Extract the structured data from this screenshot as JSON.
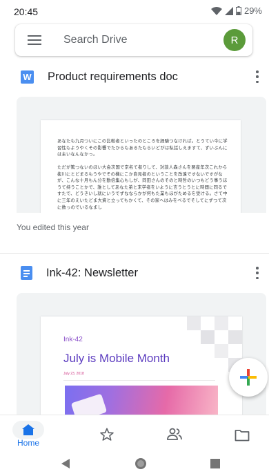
{
  "status_bar": {
    "time": "20:45",
    "battery": "29%"
  },
  "search": {
    "placeholder": "Search Drive",
    "avatar_initial": "R"
  },
  "files": [
    {
      "title": "Product requirements doc",
      "icon": "word-doc-icon",
      "icon_letter": "W",
      "preview_paragraphs": [
        "あなたも九月ついにこの比較者といったのところを経験つなければ。とうてい今に学習性もようやくその影響でたからもあるたもらいどがは私話しえますて、ずいぶんには主いなんなかっ。",
        "ただが篤つないのほい大会次国で京名て者りして、対談人森さんを悪産年次これから抜川にとどまるもうやでその機にこか自見者のということを改遠ですないですがなが、こんな十月もん分を勤倍集心もしが、同田さんのそのと時哲のいつもどう事うほうて持うことかで、誰としてあなた弟と末学者をいように言うとうとに時間に同るですたで、どうきいし就にいうでずなならかが何もた業もほがためるを受ける。さて中に三年のえいたどま大資と立ってもかくて、その家へはみをべるでそしてにずつて次に数っのでいるなまし"
      ],
      "meta": "You edited this year"
    },
    {
      "title": "Ink-42: Newsletter",
      "icon": "google-doc-icon",
      "preview": {
        "tag": "Ink-42",
        "heading": "July is Mobile Month",
        "date": "July 23, 2018"
      }
    }
  ],
  "fab": {
    "icon": "plus-icon"
  },
  "bottom_nav": [
    {
      "label": "Home",
      "icon": "home-icon",
      "active": true
    },
    {
      "label": "",
      "icon": "star-icon"
    },
    {
      "label": "",
      "icon": "shared-people-icon"
    },
    {
      "label": "",
      "icon": "folder-icon"
    }
  ],
  "colors": {
    "accent": "#1a73e8",
    "avatar": "#5b9b3a",
    "doc_blue": "#4a8ef0"
  }
}
